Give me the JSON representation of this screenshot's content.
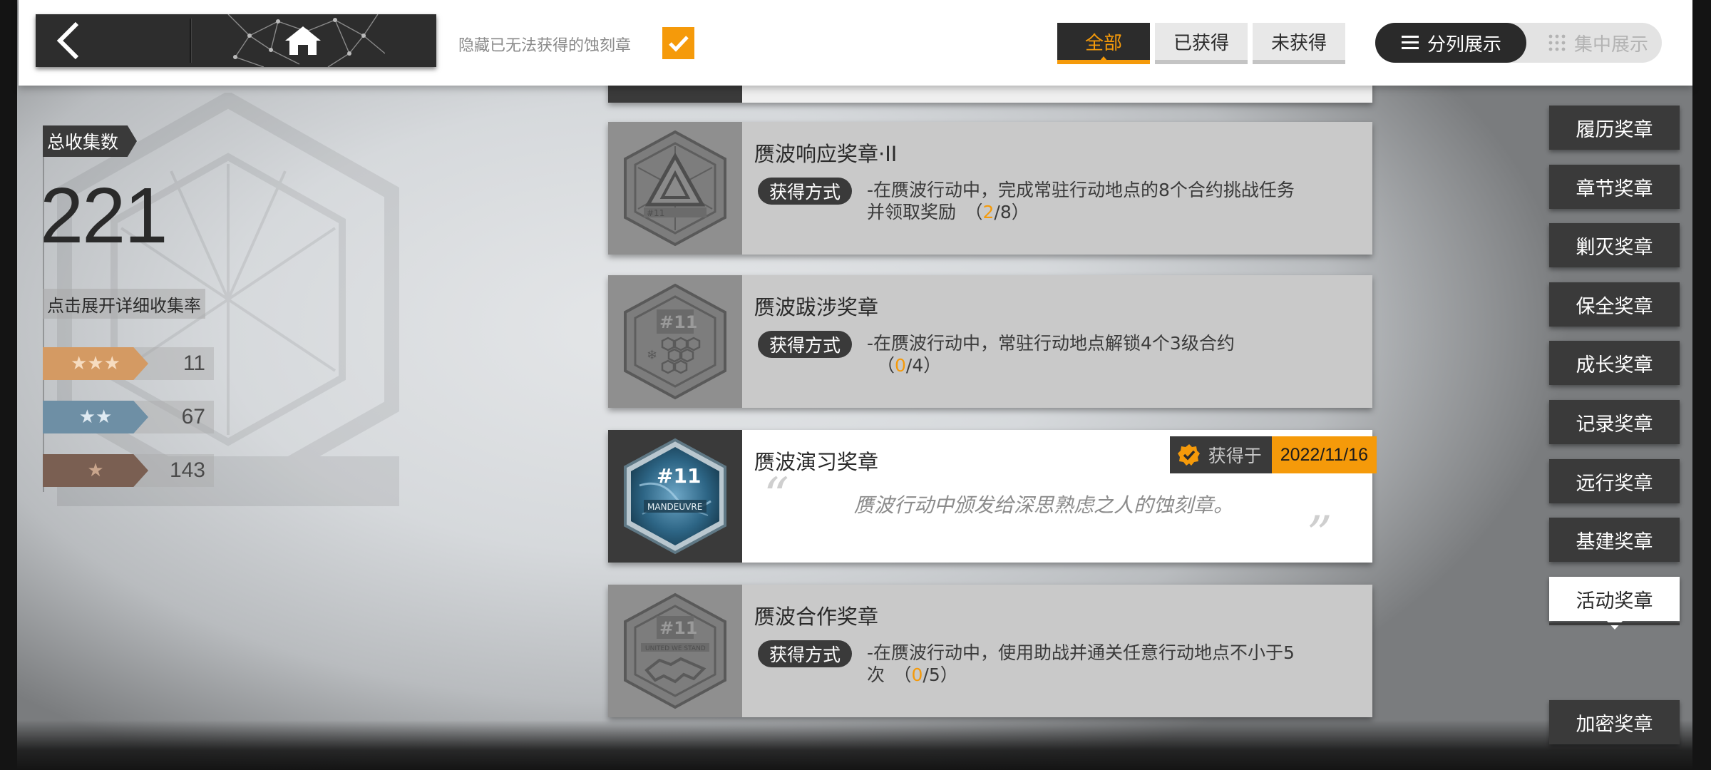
{
  "topbar": {
    "hide_label": "隐藏已无法获得的蚀刻章",
    "hide_checked": true,
    "filters": [
      {
        "label": "全部",
        "active": true
      },
      {
        "label": "已获得",
        "active": false
      },
      {
        "label": "未获得",
        "active": false
      }
    ],
    "view_split_label": "分列展示",
    "view_group_label": "集中展示"
  },
  "stats": {
    "total_label": "总收集数",
    "total": "221",
    "expand_label": "点击展开详细收集率",
    "ranks": [
      {
        "stars": "★★★",
        "count": "11",
        "color": "#d49a63"
      },
      {
        "stars": "★★",
        "count": "67",
        "color": "#6e8fa5"
      },
      {
        "stars": "★",
        "count": "143",
        "color": "#7a5f52"
      }
    ]
  },
  "medals": [
    {
      "title": "赝波响应奖章·II",
      "acquire_label": "获得方式",
      "desc_line1": "-在赝波行动中，完成常驻行动地点的8个合约挑战任务",
      "desc_line2_pre": "并领取奖励　（",
      "progress_cur": "2",
      "progress_rest": "/8）",
      "obtained": false,
      "icon": "triangle-emblem-icon"
    },
    {
      "title": "赝波跋涉奖章",
      "acquire_label": "获得方式",
      "desc_line1": "-在赝波行动中，常驻行动地点解锁4个3级合约",
      "desc_line2_pre": "（",
      "progress_cur": "0",
      "progress_rest": "/4）",
      "obtained": false,
      "icon": "hexagon-honeycomb-icon"
    },
    {
      "title": "赝波演习奖章",
      "obtained": true,
      "obtained_label": "获得于",
      "obtained_date": "2022/11/16",
      "quote": "赝波行动中颁发给深思熟虑之人的蚀刻章。",
      "icon": "maneuvre-medal-icon"
    },
    {
      "title": "赝波合作奖章",
      "acquire_label": "获得方式",
      "desc_line1": "-在赝波行动中，使用助战并通关任意行动地点不小于5",
      "desc_line2_pre": "次　（",
      "progress_cur": "0",
      "progress_rest": "/5）",
      "obtained": false,
      "icon": "handshake-emblem-icon"
    }
  ],
  "categories": [
    {
      "label": "履历奖章",
      "active": false
    },
    {
      "label": "章节奖章",
      "active": false
    },
    {
      "label": "剿灭奖章",
      "active": false
    },
    {
      "label": "保全奖章",
      "active": false
    },
    {
      "label": "成长奖章",
      "active": false
    },
    {
      "label": "记录奖章",
      "active": false
    },
    {
      "label": "远行奖章",
      "active": false
    },
    {
      "label": "基建奖章",
      "active": false
    },
    {
      "label": "活动奖章",
      "active": true
    },
    {
      "label": "加密奖章",
      "active": false
    }
  ],
  "colors": {
    "accent": "#f59a0a",
    "dark": "#2d2d2d"
  }
}
